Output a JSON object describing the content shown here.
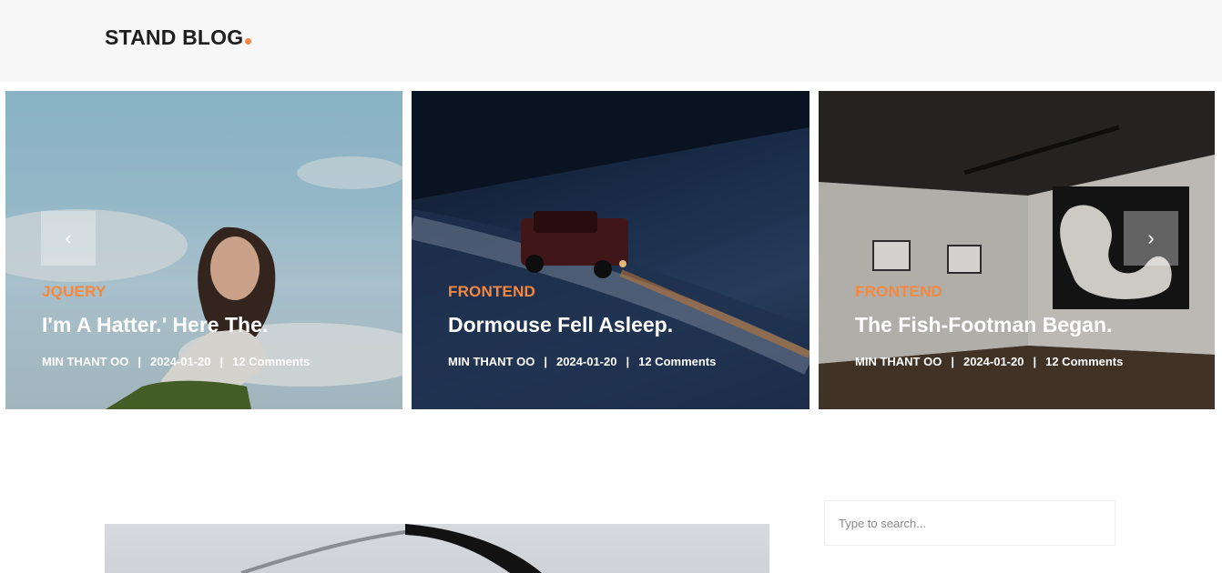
{
  "header": {
    "logo_text": "STAND BLOG"
  },
  "carousel": {
    "prev_icon": "‹",
    "next_icon": "›",
    "slides": [
      {
        "category": "JQUERY",
        "title": "I'm A Hatter.' Here The.",
        "author": "MIN THANT OO",
        "date": "2024-01-20",
        "comments": "12 Comments"
      },
      {
        "category": "FRONTEND",
        "title": "Dormouse Fell Asleep.",
        "author": "MIN THANT OO",
        "date": "2024-01-20",
        "comments": "12 Comments"
      },
      {
        "category": "FRONTEND",
        "title": "The Fish-Footman Began.",
        "author": "MIN THANT OO",
        "date": "2024-01-20",
        "comments": "12 Comments"
      }
    ]
  },
  "sidebar": {
    "search_placeholder": "Type to search..."
  },
  "colors": {
    "accent": "#f48840",
    "header_bg": "#f7f7f7"
  }
}
